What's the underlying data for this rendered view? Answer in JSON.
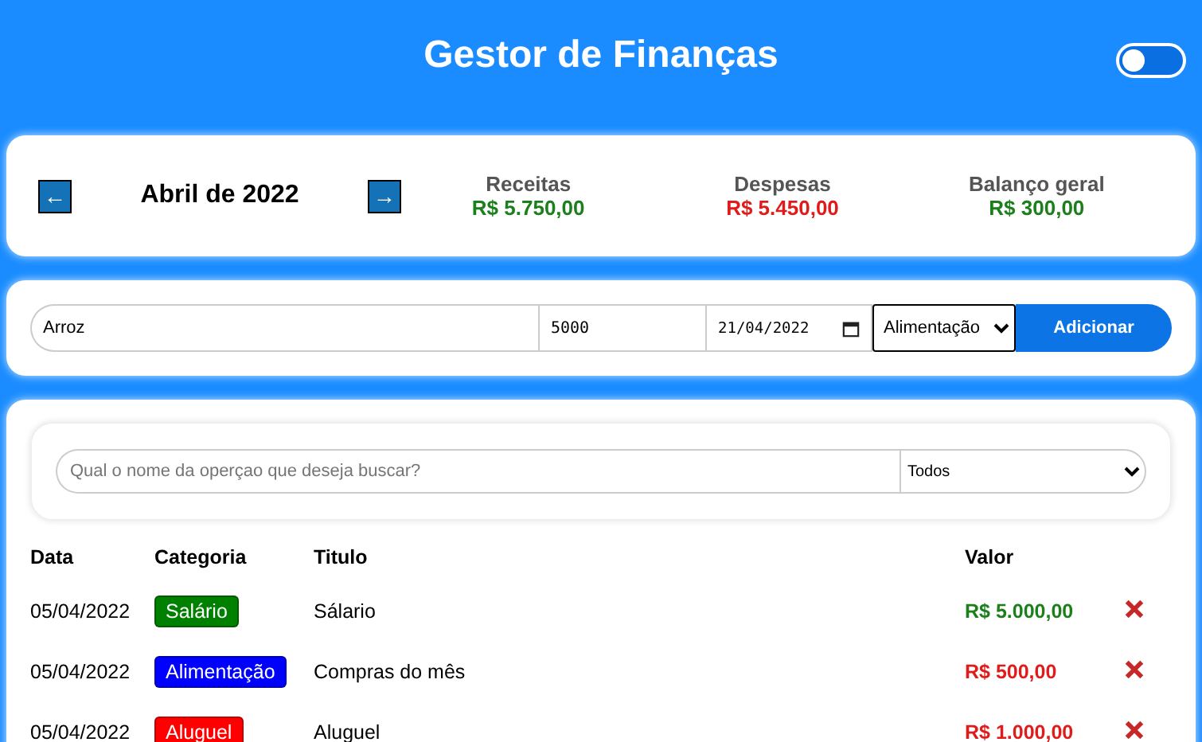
{
  "header": {
    "title": "Gestor de Finanças",
    "dark_mode_toggle": {
      "on": false
    }
  },
  "summary": {
    "month": "Abril de 2022",
    "prev": "←",
    "next": "→",
    "totals": [
      {
        "label": "Receitas",
        "value": "R$ 5.750,00",
        "kind": "positive"
      },
      {
        "label": "Despesas",
        "value": "R$ 5.450,00",
        "kind": "negative"
      },
      {
        "label": "Balanço geral",
        "value": "R$ 300,00",
        "kind": "positive"
      }
    ]
  },
  "form": {
    "title_value": "Arroz",
    "amount_value": "5000",
    "date_value": "21/04/2022",
    "category": "Alimentação",
    "button": "Adicionar"
  },
  "search": {
    "placeholder": "Qual o nome da operçao que deseja buscar?",
    "filter": "Todos"
  },
  "table": {
    "columns": [
      "Data",
      "Categoria",
      "Titulo",
      "Valor"
    ],
    "rows": [
      {
        "date": "05/04/2022",
        "category": "Salário",
        "color": "#008000",
        "title": "Sálario",
        "value": "R$ 5.000,00",
        "kind": "income"
      },
      {
        "date": "05/04/2022",
        "category": "Alimentação",
        "color": "#0000ff",
        "title": "Compras do mês",
        "value": "R$ 500,00",
        "kind": "expense"
      },
      {
        "date": "05/04/2022",
        "category": "Aluguel",
        "color": "#ff0000",
        "title": "Aluguel",
        "value": "R$ 1.000,00",
        "kind": "expense"
      }
    ]
  }
}
